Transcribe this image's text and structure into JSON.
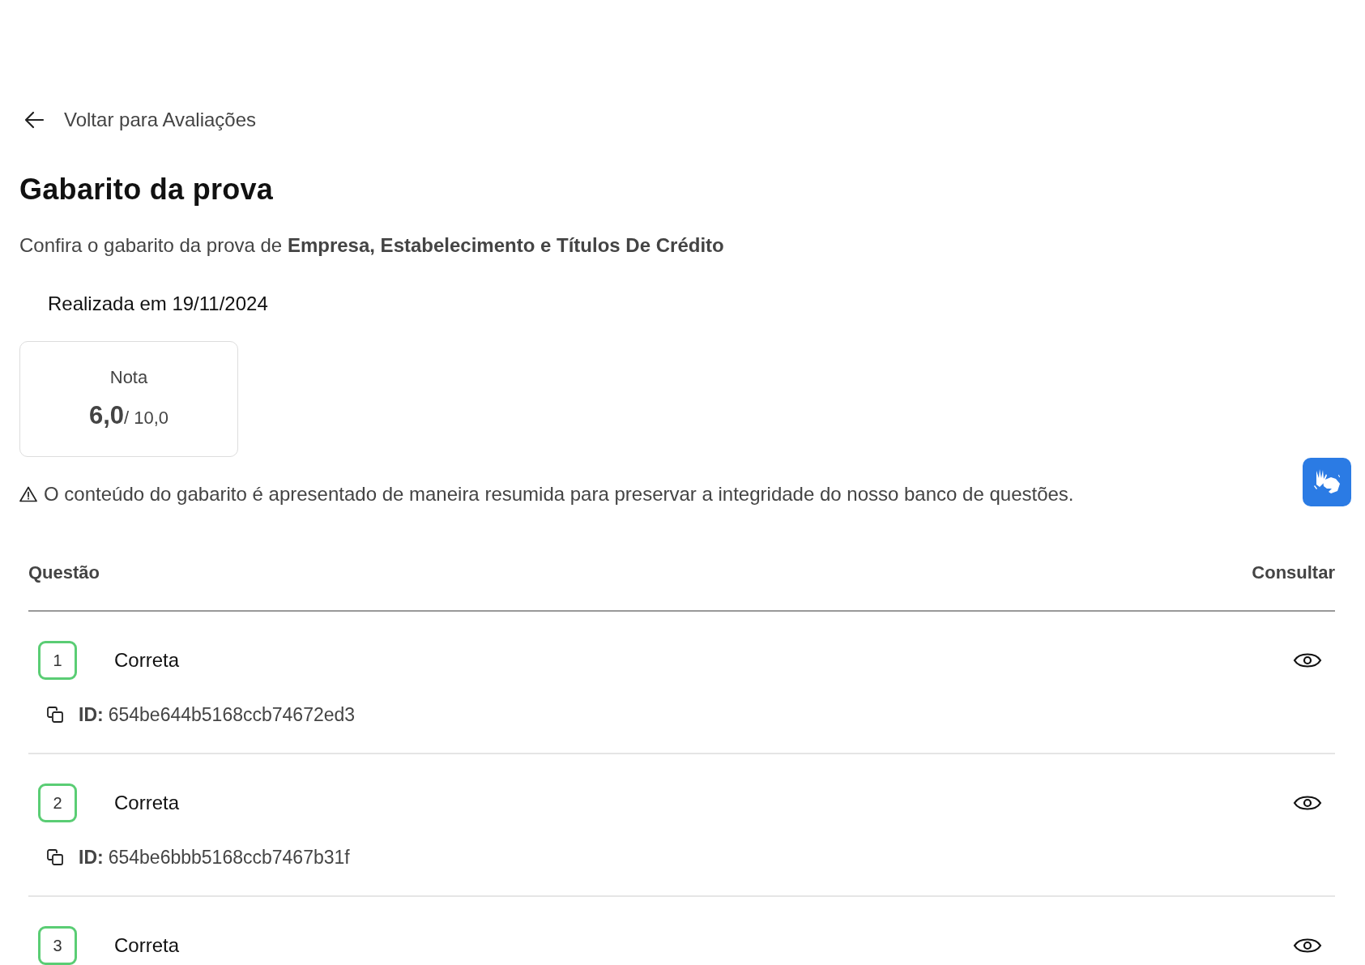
{
  "back_link": {
    "label": "Voltar para Avaliações"
  },
  "title": "Gabarito da prova",
  "subtitle": "Confira o gabarito da prova de **Empresa, Estabelecimento e Títulos De Crédito**",
  "date": "Realizada em 19/11/2024",
  "grade": {
    "label": "Nota",
    "value": "6,0",
    "max": "/ 10,0"
  },
  "notice": "O conteúdo do gabarito é apresentado de maneira resumida para preservar a integridade do nosso banco de questões.",
  "table": {
    "columns": [
      "Questão",
      "Consultar"
    ],
    "rows": [
      {
        "number": "1",
        "status": "Correta",
        "correct": true,
        "id_label": "ID:",
        "id": "654be644b5168ccb74672ed3"
      },
      {
        "number": "2",
        "status": "Correta",
        "correct": true,
        "id_label": "ID:",
        "id": "654be6bbb5168ccb7467b31f"
      },
      {
        "number": "3",
        "status": "Correta",
        "correct": true
      }
    ]
  }
}
